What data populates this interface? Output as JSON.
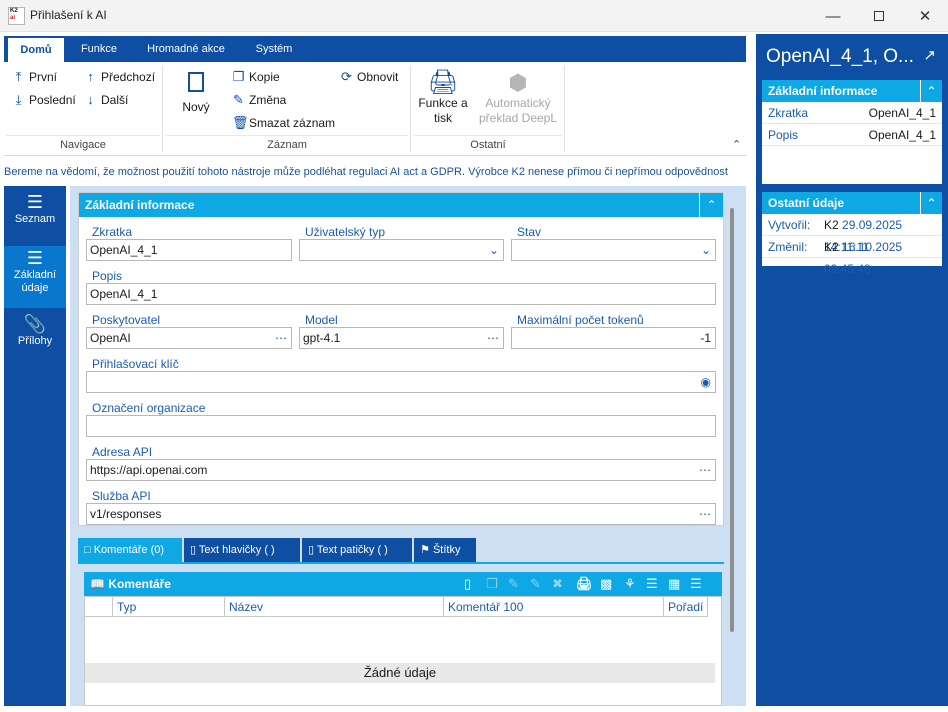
{
  "window": {
    "title": "Přihlašení k AI",
    "icon_top": "K2",
    "icon_bottom": "ai"
  },
  "ribbon_tabs": [
    "Domů",
    "Funkce",
    "Hromadné akce",
    "Systém"
  ],
  "ribbon": {
    "navigace": {
      "first": "První",
      "previous": "Předchozí",
      "last": "Poslední",
      "next": "Další",
      "label": "Navigace"
    },
    "zaznam": {
      "new": "Nový",
      "copy": "Kopie",
      "change": "Změna",
      "delete": "Smazat záznam",
      "refresh": "Obnovit",
      "label": "Záznam"
    },
    "ostatni": {
      "print_line1": "Funkce a",
      "print_line2": "tisk",
      "deepl_line1": "Automatický",
      "deepl_line2": "překlad DeepL",
      "label": "Ostatní"
    }
  },
  "notice": "Bereme na vědomí, že možnost použití tohoto nástroje může podléhat regulaci AI act a GDPR. Výrobce K2 nenese přímou či nepřímou odpovědnost",
  "left_nav": [
    {
      "label1": "Seznam",
      "label2": ""
    },
    {
      "label1": "Základní",
      "label2": "údaje"
    },
    {
      "label1": "Přílohy",
      "label2": ""
    }
  ],
  "form": {
    "section_title": "Základní informace",
    "zkratka": {
      "label": "Zkratka",
      "value": "OpenAI_4_1"
    },
    "uzivatelsky_typ": {
      "label": "Uživatelský typ",
      "value": ""
    },
    "stav": {
      "label": "Stav",
      "value": ""
    },
    "popis": {
      "label": "Popis",
      "value": "OpenAI_4_1"
    },
    "poskytovatel": {
      "label": "Poskytovatel",
      "value": "OpenAI"
    },
    "model": {
      "label": "Model",
      "value": "gpt-4.1"
    },
    "max_tokens": {
      "label": "Maximální počet tokenů",
      "value": "-1"
    },
    "klic": {
      "label": "Přihlašovací klíč",
      "value": ""
    },
    "organizace": {
      "label": "Označení organizace",
      "value": ""
    },
    "adresa": {
      "label": "Adresa API",
      "value": "https://api.openai.com"
    },
    "sluzba": {
      "label": "Služba API",
      "value": "v1/responses"
    }
  },
  "bottom_tabs": [
    "Komentáře (0)",
    "Text hlavičky ( )",
    "Text patičky ( )",
    "Štítky"
  ],
  "comments": {
    "title": "Komentáře",
    "columns": [
      "Typ",
      "Název",
      "Komentář 100",
      "Pořadí"
    ],
    "empty": "Žádné údaje"
  },
  "right_panel": {
    "title": "OpenAI_4_1, O...",
    "basic": {
      "title": "Základní informace",
      "rows": [
        {
          "k": "Zkratka",
          "v": "OpenAI_4_1"
        },
        {
          "k": "Popis",
          "v": "OpenAI_4_1"
        }
      ]
    },
    "other": {
      "title": "Ostatní údaje",
      "created": {
        "k": "Vytvořil:",
        "user": "K2",
        "date": "29.09.2025 14:11:11"
      },
      "changed": {
        "k": "Změnil:",
        "user": "K2",
        "date": "16.10.2025 09:45:48"
      }
    }
  },
  "colors": {
    "primary": "#0e4ea3",
    "accent": "#0ea8e5",
    "nav_active": "#0a77cf",
    "label": "#1c5bb0"
  }
}
